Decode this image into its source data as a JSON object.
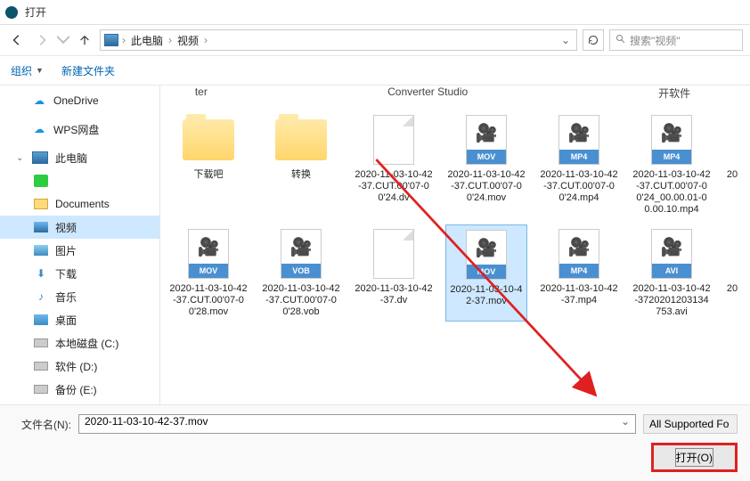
{
  "window": {
    "title": "打开"
  },
  "nav": {
    "crumb1": "此电脑",
    "crumb2": "视频",
    "search_placeholder": "搜索\"视频\""
  },
  "toolbar": {
    "organize": "组织",
    "newfolder": "新建文件夹"
  },
  "sidebar": {
    "onedrive": "OneDrive",
    "wps": "WPS网盘",
    "thispc": "此电脑",
    "green_item": "",
    "documents": "Documents",
    "videos": "视频",
    "pictures": "图片",
    "downloads": "下载",
    "music": "音乐",
    "desktop": "桌面",
    "diskc": "本地磁盘 (C:)",
    "diskd": "软件 (D:)",
    "diske": "备份 (E:)"
  },
  "header_cutoff": {
    "left": "ter",
    "mid": "Converter Studio",
    "right": "开软件"
  },
  "files": {
    "r1": {
      "f1": {
        "name": "下载吧",
        "type": "folder"
      },
      "f2": {
        "name": "转换",
        "type": "folder"
      },
      "f3": {
        "name": "2020-11-03-10-42-37.CUT.00'07-00'24.dv",
        "type": "blank"
      },
      "f4": {
        "name": "2020-11-03-10-42-37.CUT.00'07-00'24.mov",
        "ext": "MOV"
      },
      "f5": {
        "name": "2020-11-03-10-42-37.CUT.00'07-00'24.mp4",
        "ext": "MP4"
      },
      "f6": {
        "name": "2020-11-03-10-42-37.CUT.00'07-00'24_00.00.01-00.00.10.mp4",
        "ext": "MP4"
      },
      "f7": {
        "name": "20",
        "type": "cut"
      }
    },
    "r2": {
      "f1": {
        "name": "2020-11-03-10-42-37.CUT.00'07-00'28.mov",
        "ext": "MOV"
      },
      "f2": {
        "name": "2020-11-03-10-42-37.CUT.00'07-00'28.vob",
        "ext": "VOB"
      },
      "f3": {
        "name": "2020-11-03-10-42-37.dv",
        "type": "blank"
      },
      "f4": {
        "name": "2020-11-03-10-42-37.mov",
        "ext": "MOV",
        "selected": true
      },
      "f5": {
        "name": "2020-11-03-10-42-37.mp4",
        "ext": "MP4"
      },
      "f6": {
        "name": "2020-11-03-10-42-3720201203134753.avi",
        "ext": "AVI"
      },
      "f7": {
        "name": "20",
        "type": "cut"
      }
    }
  },
  "footer": {
    "filename_label": "文件名(N):",
    "filename_value": "2020-11-03-10-42-37.mov",
    "filter": "All Supported Fo",
    "open_btn": "打开(O)"
  }
}
